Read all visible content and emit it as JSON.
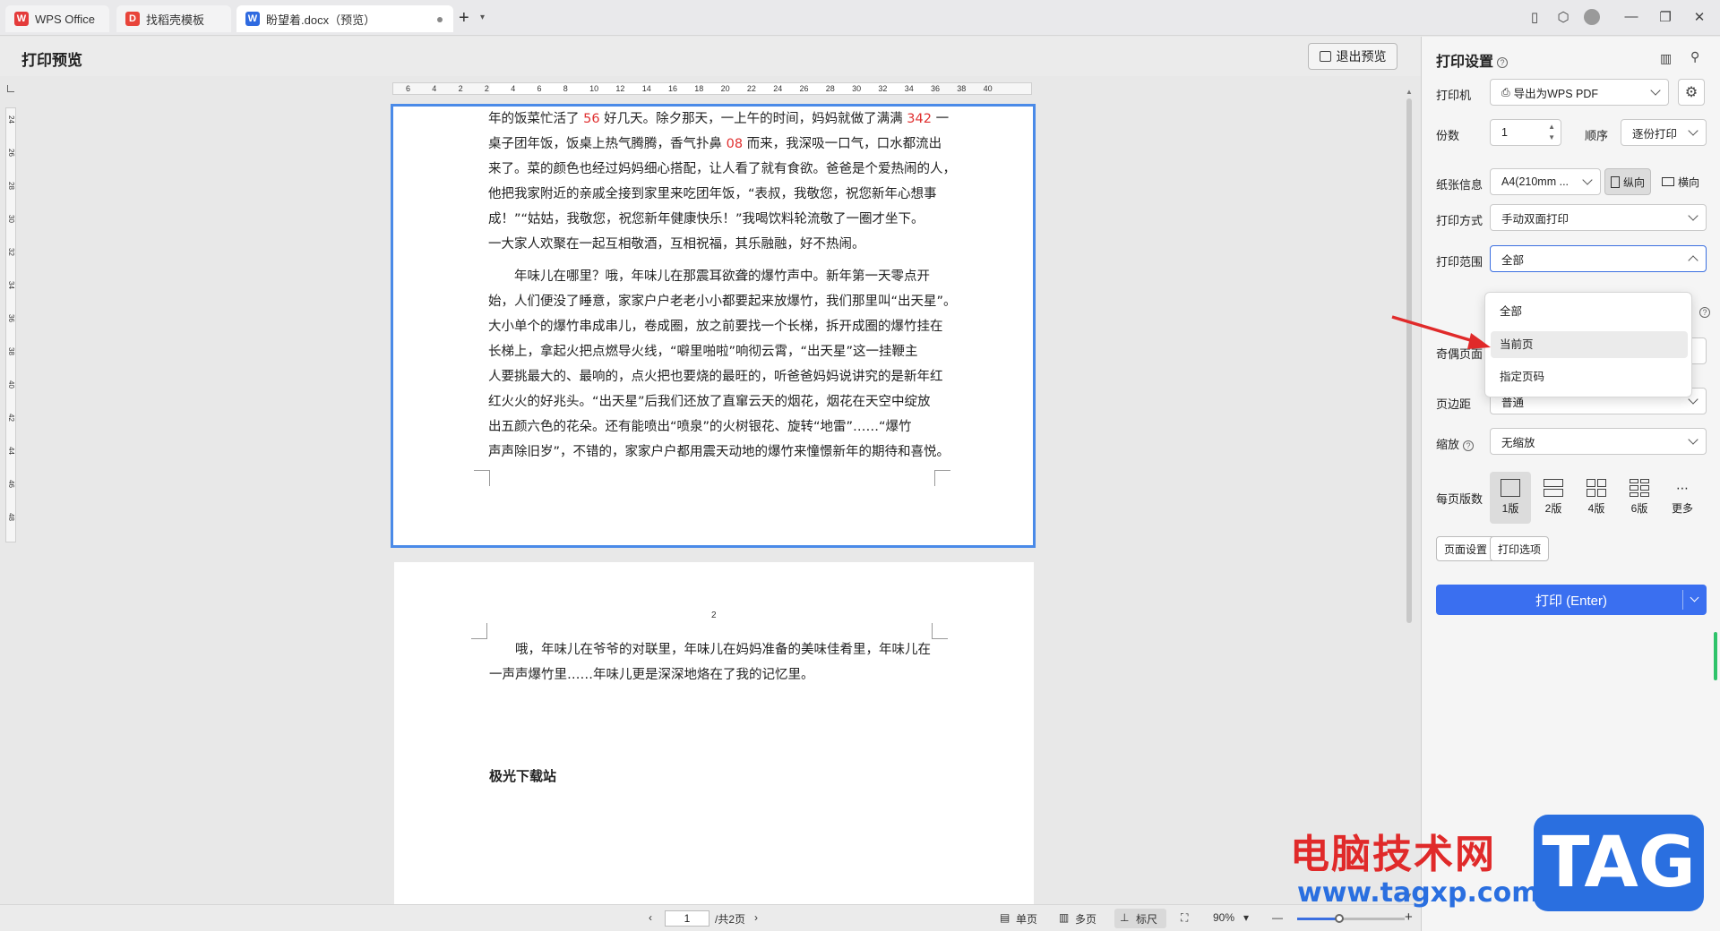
{
  "tabs": [
    {
      "label": "WPS Office",
      "icon": "wps-logo-icon",
      "color": "#e43b3b"
    },
    {
      "label": "找稻壳模板",
      "icon": "docer-icon",
      "color": "#e8443a"
    },
    {
      "label": "盼望着.docx（预览）",
      "icon": "word-doc-icon",
      "color": "#2f6ae0"
    }
  ],
  "preview": {
    "title": "打印预览",
    "exit_label": "退出预览",
    "ruler_h": [
      "6",
      "4",
      "2",
      "2",
      "4",
      "6",
      "8",
      "10",
      "12",
      "14",
      "16",
      "18",
      "20",
      "22",
      "24",
      "26",
      "28",
      "30",
      "32",
      "34",
      "36",
      "38",
      "40"
    ],
    "ruler_v": [
      "24",
      "26",
      "28",
      "30",
      "32",
      "34",
      "36",
      "38",
      "40",
      "42",
      "44",
      "46",
      "48"
    ]
  },
  "page1": {
    "lines_p1": [
      [
        "年的饭菜忙活了 ",
        "56",
        " 好几天。除夕那天，一上午的时间，妈妈就做了满满 ",
        "342",
        " 一"
      ],
      [
        "桌子团年饭，饭桌上热气腾腾，香气扑鼻 ",
        "08",
        " 而来，我深吸一口气，口水都流出"
      ],
      [
        "来了。菜的颜色也经过妈妈细心搭配，让人看了就有食欲。爸爸是个爱热闹的人，"
      ],
      [
        "他把我家附近的亲戚全接到家里来吃团年饭，“表叔，我敬您，祝您新年心想事"
      ],
      [
        "成！”“姑姑，我敬您，祝您新年健康快乐！”我喝饮料轮流敬了一圈才坐下。"
      ],
      [
        "一大家人欢聚在一起互相敬酒，互相祝福，其乐融融，好不热闹。"
      ]
    ],
    "lines_p2": [
      "　　年味儿在哪里？哦，年味儿在那震耳欲聋的爆竹声中。新年第一天零点开",
      "始，人们便没了睡意，家家户户老老小小都要起来放爆竹，我们那里叫“出天星”。",
      "大小单个的爆竹串成串儿，卷成圈，放之前要找一个长梯，拆开成圈的爆竹挂在",
      "长梯上，拿起火把点燃导火线，“噼里啪啦”响彻云霄，“出天星”这一挂鞭主",
      "人要挑最大的、最响的，点火把也要烧的最旺的，听爸爸妈妈说讲究的是新年红",
      "红火火的好兆头。“出天星”后我们还放了直窜云天的烟花，烟花在天空中绽放",
      "出五颜六色的花朵。还有能喷出“喷泉”的火树银花、旋转“地雷”……“爆竹",
      "声声除旧岁”，不错的，家家户户都用震天动地的爆竹来憧憬新年的期待和喜悦。"
    ]
  },
  "page2": {
    "page_number": "2",
    "lines": [
      "　　哦，年味儿在爷爷的对联里，年味儿在妈妈准备的美味佳肴里，年味儿在",
      "一声声爆竹里……年味儿更是深深地烙在了我的记忆里。"
    ],
    "signature": "极光下载站"
  },
  "statusbar": {
    "current_page": "1",
    "total_pages": "/共2页",
    "single_page": "单页",
    "multi_page": "多页",
    "ruler": "标尺",
    "zoom": "90%",
    "zoom_level": 0.4
  },
  "settings": {
    "title": "打印设置",
    "printer_label": "打印机",
    "printer_value": "导出为WPS PDF",
    "copies_label": "份数",
    "copies_value": "1",
    "order_label": "顺序",
    "order_value": "逐份打印",
    "paper_label": "纸张信息",
    "paper_value": "A4(210mm ...",
    "portrait": "纵向",
    "landscape": "横向",
    "mode_label": "打印方式",
    "mode_value": "手动双面打印",
    "range_label": "打印范围",
    "range_value": "全部",
    "range_options": [
      "全部",
      "当前页",
      "指定页码"
    ],
    "odd_even_label": "奇偶页面",
    "margin_label": "页边距",
    "margin_value": "普通",
    "scale_label": "缩放",
    "scale_value": "无缩放",
    "per_page_label": "每页版数",
    "per_page_options": [
      "1版",
      "2版",
      "4版",
      "6版",
      "更多"
    ],
    "page_setup": "页面设置",
    "print_options": "打印选项",
    "print_button": "打印 (Enter)"
  },
  "watermark": {
    "cn": "电脑技术网",
    "url": "www.tagxp.com",
    "tag": "TAG"
  },
  "colors": {
    "accent": "#3a6ff0",
    "highlight_red": "#e03030",
    "arrow": "#e02a2a"
  }
}
